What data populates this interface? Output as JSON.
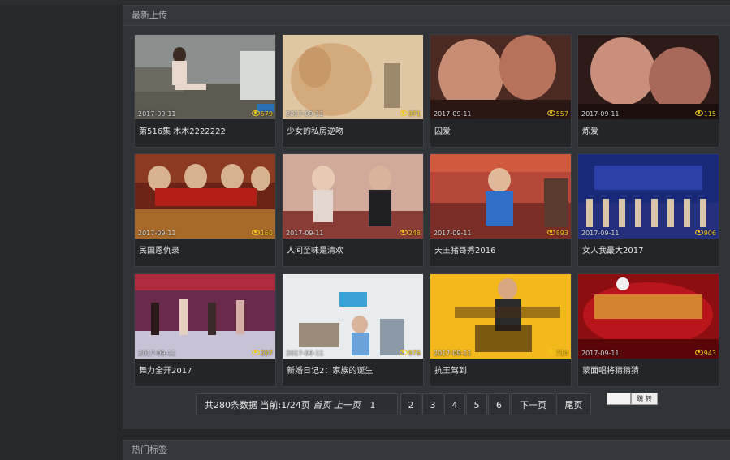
{
  "section_latest": {
    "title": "最新上传"
  },
  "section_tags": {
    "title": "热门标签"
  },
  "videos": [
    {
      "date": "2017-09-11",
      "views": "579",
      "title": "第516集 木木2222222"
    },
    {
      "date": "2017-09-11",
      "views": "371",
      "title": "少女的私房逆吻"
    },
    {
      "date": "2017-09-11",
      "views": "557",
      "title": "囚爱"
    },
    {
      "date": "2017-09-11",
      "views": "115",
      "title": "炼爱"
    },
    {
      "date": "2017-09-11",
      "views": "160",
      "title": "民国恩仇录"
    },
    {
      "date": "2017-09-11",
      "views": "248",
      "title": "人间至味是清欢"
    },
    {
      "date": "2017-09-11",
      "views": "893",
      "title": "天王猪哥秀2016"
    },
    {
      "date": "2017-09-11",
      "views": "906",
      "title": "女人我最大2017"
    },
    {
      "date": "2017-09-11",
      "views": "207",
      "title": "舞力全开2017"
    },
    {
      "date": "2017-09-11",
      "views": "976",
      "title": "新婚日记2：家族的诞生"
    },
    {
      "date": "2017-09-11",
      "views": "714",
      "title": "抗王驾到"
    },
    {
      "date": "2017-09-11",
      "views": "943",
      "title": "蒙面唱将猜猜猜"
    }
  ],
  "pagination": {
    "info": "共280条数据 当前:1/24页",
    "first": "首页",
    "prev": "上一页",
    "current": "1",
    "pages": [
      "2",
      "3",
      "4",
      "5",
      "6"
    ],
    "next": "下一页",
    "last": "尾页",
    "jump_label": "跳 转"
  },
  "colors": {
    "background": "#25272a",
    "panel": "#303338",
    "views_accent": "#f2c81a"
  }
}
